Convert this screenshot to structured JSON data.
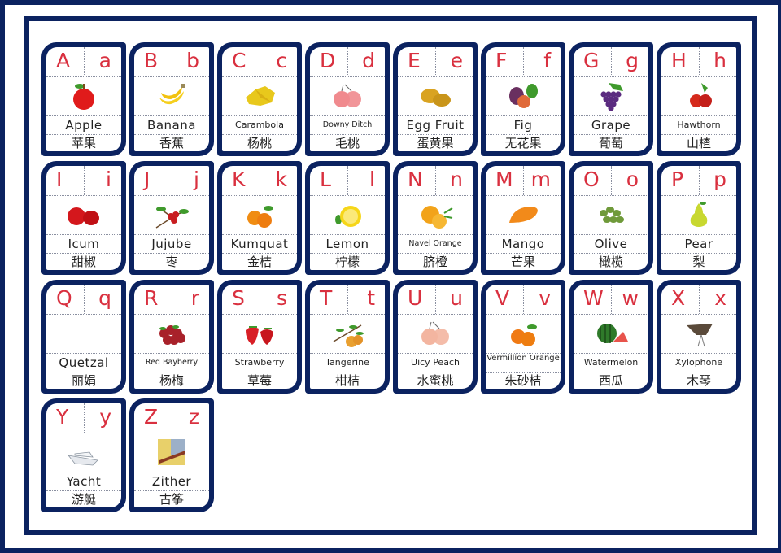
{
  "colors": {
    "frame": "#0b2260",
    "letter": "#d9303f",
    "text": "#222222",
    "background": "#ffffff"
  },
  "cards": [
    {
      "upper": "A",
      "lower": "a",
      "english": "Apple",
      "chinese": "苹果",
      "icon": "apple-icon",
      "color": "#e01b1b",
      "size": "normal"
    },
    {
      "upper": "B",
      "lower": "b",
      "english": "Banana",
      "chinese": "香蕉",
      "icon": "banana-icon",
      "color": "#f5cf1f",
      "size": "normal"
    },
    {
      "upper": "C",
      "lower": "c",
      "english": "Carambola",
      "chinese": "杨桃",
      "icon": "carambola-icon",
      "color": "#e8c81c",
      "size": "small"
    },
    {
      "upper": "D",
      "lower": "d",
      "english": "Downy Ditch",
      "chinese": "毛桃",
      "icon": "peach-icon",
      "color": "#f08a8e",
      "size": "xsmall"
    },
    {
      "upper": "E",
      "lower": "e",
      "english": "Egg Fruit",
      "chinese": "蛋黄果",
      "icon": "egg-fruit-icon",
      "color": "#d9a321",
      "size": "normal"
    },
    {
      "upper": "F",
      "lower": "f",
      "english": "Fig",
      "chinese": "无花果",
      "icon": "fig-icon",
      "color": "#6a3060",
      "size": "normal"
    },
    {
      "upper": "G",
      "lower": "g",
      "english": "Grape",
      "chinese": "葡萄",
      "icon": "grape-icon",
      "color": "#5b2b80",
      "size": "normal"
    },
    {
      "upper": "H",
      "lower": "h",
      "english": "Hawthorn",
      "chinese": "山楂",
      "icon": "hawthorn-icon",
      "color": "#d52a1c",
      "size": "small"
    },
    {
      "upper": "I",
      "lower": "i",
      "english": "Icum",
      "chinese": "甜椒",
      "icon": "pepper-icon",
      "color": "#d4171c",
      "size": "normal"
    },
    {
      "upper": "J",
      "lower": "j",
      "english": "Jujube",
      "chinese": "枣",
      "icon": "jujube-icon",
      "color": "#c81d20",
      "size": "normal"
    },
    {
      "upper": "K",
      "lower": "k",
      "english": "Kumquat",
      "chinese": "金桔",
      "icon": "kumquat-icon",
      "color": "#f08c12",
      "size": "normal"
    },
    {
      "upper": "L",
      "lower": "l",
      "english": "Lemon",
      "chinese": "柠檬",
      "icon": "lemon-icon",
      "color": "#f6d619",
      "size": "normal"
    },
    {
      "upper": "N",
      "lower": "n",
      "english": "Navel Orange",
      "chinese": "脐橙",
      "icon": "orange-icon",
      "color": "#f2a31a",
      "size": "xsmall"
    },
    {
      "upper": "M",
      "lower": "m",
      "english": "Mango",
      "chinese": "芒果",
      "icon": "mango-icon",
      "color": "#f28a1a",
      "size": "normal"
    },
    {
      "upper": "O",
      "lower": "o",
      "english": "Olive",
      "chinese": "橄榄",
      "icon": "olive-icon",
      "color": "#6f9a3a",
      "size": "normal"
    },
    {
      "upper": "P",
      "lower": "p",
      "english": "Pear",
      "chinese": "梨",
      "icon": "pear-icon",
      "color": "#c8d830",
      "size": "normal"
    },
    {
      "upper": "Q",
      "lower": "q",
      "english": "Quetzal",
      "chinese": "丽娟",
      "icon": "none",
      "color": "#ffffff",
      "size": "normal"
    },
    {
      "upper": "R",
      "lower": "r",
      "english": "Red Bayberry",
      "chinese": "杨梅",
      "icon": "bayberry-icon",
      "color": "#a8212a",
      "size": "xsmall"
    },
    {
      "upper": "S",
      "lower": "s",
      "english": "Strawberry",
      "chinese": "草莓",
      "icon": "strawberry-icon",
      "color": "#d81f26",
      "size": "small"
    },
    {
      "upper": "T",
      "lower": "t",
      "english": "Tangerine",
      "chinese": "柑桔",
      "icon": "tangerine-icon",
      "color": "#e9a030",
      "size": "small"
    },
    {
      "upper": "U",
      "lower": "u",
      "english": "Uicy Peach",
      "chinese": "水蜜桃",
      "icon": "juicy-peach-icon",
      "color": "#f3b5a0",
      "size": "small"
    },
    {
      "upper": "V",
      "lower": "v",
      "english": "Vermillion Orange",
      "chinese": "朱砂桔",
      "icon": "vermillion-orange-icon",
      "color": "#f07a14",
      "size": "twoline"
    },
    {
      "upper": "W",
      "lower": "w",
      "english": "Watermelon",
      "chinese": "西瓜",
      "icon": "watermelon-icon",
      "color": "#2f7a2a",
      "size": "small"
    },
    {
      "upper": "X",
      "lower": "x",
      "english": "Xylophone",
      "chinese": "木琴",
      "icon": "xylophone-icon",
      "color": "#5a4a3a",
      "size": "small"
    },
    {
      "upper": "Y",
      "lower": "y",
      "english": "Yacht",
      "chinese": "游艇",
      "icon": "yacht-icon",
      "color": "#e6e9ee",
      "size": "normal"
    },
    {
      "upper": "Z",
      "lower": "z",
      "english": "Zither",
      "chinese": "古筝",
      "icon": "zither-icon",
      "color": "#8a3a22",
      "size": "normal"
    }
  ]
}
